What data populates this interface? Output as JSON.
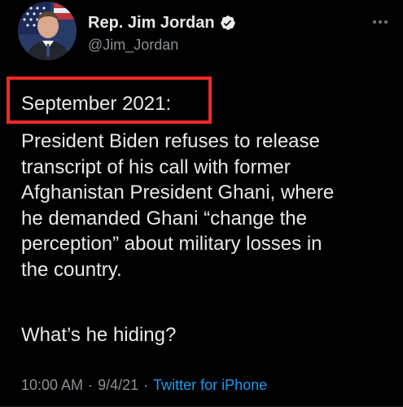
{
  "account": {
    "display_name": "Rep. Jim Jordan",
    "handle": "@Jim_Jordan",
    "verified": true,
    "avatar_icon": "profile-photo-flag-background",
    "verified_icon": "verified-badge-icon"
  },
  "tweet": {
    "date_heading": "September 2021:",
    "body": "President Biden refuses to release\ntranscript of his call with former\nAfghanistan President Ghani, where\nhe demanded Ghani “change the\nperception” about military losses in\nthe country.",
    "question": "What’s he hiding?"
  },
  "meta": {
    "time": "10:00 AM",
    "separator": "·",
    "date": "9/4/21",
    "source": "Twitter for iPhone"
  },
  "colors": {
    "background": "#000000",
    "text": "#e7e9ea",
    "secondary": "#8b9096",
    "link": "#1d9bf0",
    "highlight_border": "#ee2a24"
  },
  "icons": {
    "more": "more-horizontal-icon"
  }
}
